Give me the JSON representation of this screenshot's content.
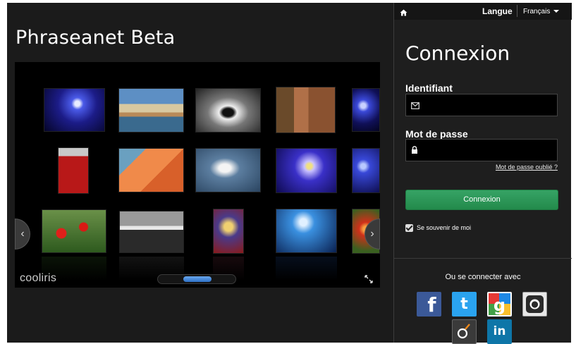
{
  "app": {
    "title": "Phraseanet Beta"
  },
  "gallery": {
    "brand": "cooliris",
    "thumbnails": [
      {
        "name": "concert-blue",
        "colors": [
          "#1a1a6e",
          "#3b4fd8",
          "#d9e0ff"
        ]
      },
      {
        "name": "river-town",
        "colors": [
          "#5b87b6",
          "#c8a878",
          "#3a5a78"
        ]
      },
      {
        "name": "tunnel",
        "colors": [
          "#888888",
          "#eeeeee",
          "#333333"
        ]
      },
      {
        "name": "venice-canal",
        "colors": [
          "#7a5a32",
          "#3a7a6a",
          "#c07a4a"
        ]
      },
      {
        "name": "concert-blue-2",
        "colors": [
          "#10105a",
          "#2d3fc8",
          "#9aa8ff"
        ]
      },
      {
        "name": "red-vehicle",
        "colors": [
          "#b01818",
          "#e24a4a",
          "#f1f1f1"
        ]
      },
      {
        "name": "flamingos",
        "colors": [
          "#e86a2a",
          "#f0a060",
          "#6aa0c0"
        ]
      },
      {
        "name": "seagulls",
        "colors": [
          "#486a90",
          "#d9e4ee",
          "#2a4060"
        ]
      },
      {
        "name": "stage-lights",
        "colors": [
          "#1a1070",
          "#d0c4ff",
          "#f0c020"
        ]
      },
      {
        "name": "concert-blue-3",
        "colors": [
          "#141460",
          "#3a52e0",
          "#b0c0ff"
        ]
      },
      {
        "name": "poppies",
        "colors": [
          "#d0201a",
          "#3a7a2a",
          "#7aa050"
        ]
      },
      {
        "name": "london-skyline",
        "colors": [
          "#777777",
          "#dddddd",
          "#222222"
        ]
      },
      {
        "name": "carnival-mask",
        "colors": [
          "#3a2a7a",
          "#e0c060",
          "#a02020"
        ]
      },
      {
        "name": "concert-crowd",
        "colors": [
          "#0a2a60",
          "#3090e0",
          "#c0e0ff"
        ]
      },
      {
        "name": "red-flower",
        "colors": [
          "#c82a10",
          "#f08030",
          "#3a6020"
        ]
      }
    ]
  },
  "topbar": {
    "language_label": "Langue",
    "language_value": "Français"
  },
  "login": {
    "title": "Connexion",
    "username_label": "Identifiant",
    "username_value": "",
    "password_label": "Mot de passe",
    "password_value": "",
    "forgot_link": "Mot de passe oublié ?",
    "submit_label": "Connexion",
    "remember_label": "Se souvenir de moi",
    "remember_checked": true
  },
  "social": {
    "title": "Ou se connecter avec",
    "providers": [
      {
        "name": "facebook",
        "color": "#3b5998"
      },
      {
        "name": "twitter",
        "color": "#2aa3ef"
      },
      {
        "name": "google",
        "color": "#ffffff"
      },
      {
        "name": "github",
        "color": "#e8e8e8"
      },
      {
        "name": "viadeo",
        "color": "#3a3a3a"
      },
      {
        "name": "linkedin",
        "color": "#0e76a8"
      }
    ]
  }
}
